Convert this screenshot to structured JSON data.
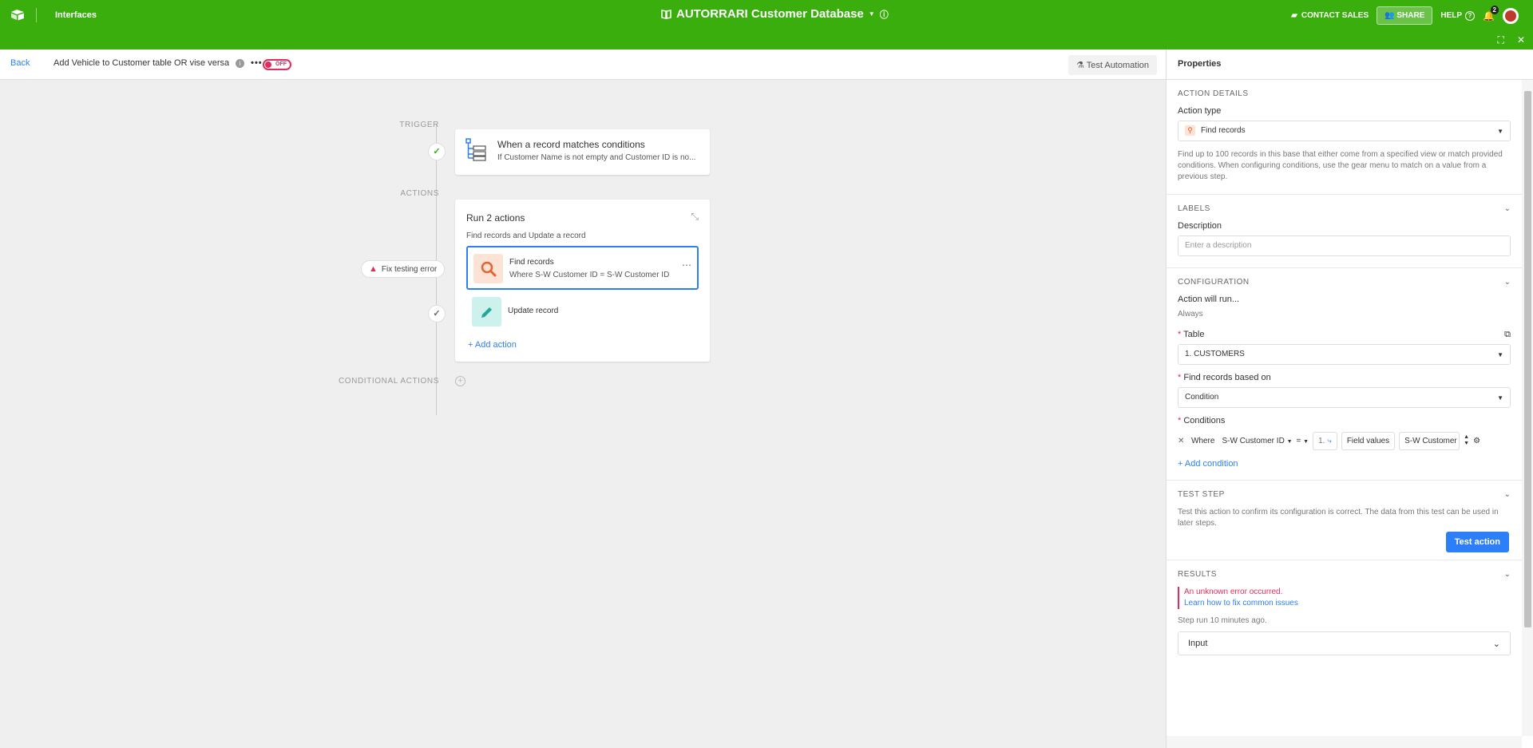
{
  "topbar": {
    "interfaces_label": "Interfaces",
    "base_title": "AUTORRARI Customer Database",
    "contact_sales": "CONTACT SALES",
    "share": "SHARE",
    "help": "HELP",
    "notification_count": "2"
  },
  "subbar": {
    "back": "Back",
    "automation_name": "Add Vehicle to Customer table OR vise versa",
    "toggle_label": "OFF",
    "test_automation": "Test Automation"
  },
  "canvas": {
    "trigger_label": "TRIGGER",
    "actions_label": "ACTIONS",
    "conditional_label": "CONDITIONAL ACTIONS",
    "trigger": {
      "title": "When a record matches conditions",
      "desc": "If Customer Name is not empty and Customer ID is no..."
    },
    "actions": {
      "title": "Run 2 actions",
      "subtitle": "Find records and Update a record",
      "items": [
        {
          "name": "Find records",
          "desc": "Where S-W Customer ID = S-W Customer ID"
        },
        {
          "name": "Update record",
          "desc": ""
        }
      ],
      "add_action": "Add action"
    },
    "error_pill": "Fix testing error"
  },
  "panel": {
    "title": "Properties",
    "action_details": {
      "section": "ACTION DETAILS",
      "action_type_label": "Action type",
      "action_type_value": "Find records",
      "help": "Find up to 100 records in this base that either come from a specified view or match provided conditions. When configuring conditions, use the gear menu to match on a value from a previous step."
    },
    "labels": {
      "section": "LABELS",
      "description_label": "Description",
      "description_placeholder": "Enter a description"
    },
    "configuration": {
      "section": "CONFIGURATION",
      "run_label": "Action will run...",
      "run_value": "Always",
      "table_label": "Table",
      "table_value": "1. CUSTOMERS",
      "find_based_label": "Find records based on",
      "find_based_value": "Condition",
      "conditions_label": "Conditions",
      "cond_where": "Where",
      "cond_field": "S-W Customer ID",
      "cond_op": "=",
      "cond_step": "1.",
      "cond_field_values": "Field values",
      "cond_value": "S-W Customer",
      "add_condition": "Add condition"
    },
    "test_step": {
      "section": "TEST STEP",
      "help": "Test this action to confirm its configuration is correct. The data from this test can be used in later steps.",
      "button": "Test action"
    },
    "results": {
      "section": "RESULTS",
      "error": "An unknown error occurred.",
      "error_link": "Learn how to fix common issues",
      "step_run": "Step run 10 minutes ago.",
      "input_label": "Input"
    }
  },
  "colors": {
    "brand_green": "#39ae0c",
    "accent_blue": "#2d7ff9",
    "error_red": "#e02d5b"
  }
}
